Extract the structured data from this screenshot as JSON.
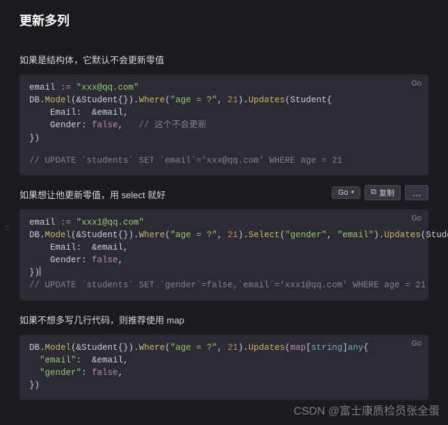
{
  "title": "更新多列",
  "para1": "如果是结构体，它默认不会更新零值",
  "para2": "如果想让他更新零值，用 select 就好",
  "para3": "如果不想多写几行代码，则推荐使用 map",
  "lang": "Go",
  "controls": {
    "go_label": "Go",
    "copy_label": "复制",
    "more": "…"
  },
  "gutter": "::",
  "watermark": "CSDN @富士康质检员张全蛋",
  "block1": {
    "l1a": "email ",
    "l1op": ":= ",
    "l1str": "\"xxx@qq.com\"",
    "l2a": "DB.",
    "l2fn1": "Model",
    "l2b": "(&Student{}).",
    "l2fn2": "Where",
    "l2c": "(",
    "l2str": "\"age = ?\"",
    "l2d": ", ",
    "l2num": "21",
    "l2e": ").",
    "l2fn3": "Updates",
    "l2f": "(Student{",
    "l3": "    Email:  &email,",
    "l4a": "    Gender: ",
    "l4b": "false",
    "l4c": ",   ",
    "l4cmt": "// 这个不会更新",
    "l5": "})",
    "cmt2": "// UPDATE `students` SET `email`='xxx@qq.com' WHERE age = 21"
  },
  "block2": {
    "l1a": "email ",
    "l1op": ":= ",
    "l1str": "\"xxx1@qq.com\"",
    "l2a": "DB.",
    "l2fn1": "Model",
    "l2b": "(&Student{}).",
    "l2fn2": "Where",
    "l2c": "(",
    "l2str": "\"age = ?\"",
    "l2d": ", ",
    "l2num": "21",
    "l2e": ").",
    "l2fn3": "Select",
    "l2f": "(",
    "l2sg": "\"gender\"",
    "l2g": ", ",
    "l2se": "\"email\"",
    "l2h": ").",
    "l2fn4": "Updates",
    "l2i": "(Student{",
    "l3": "    Email:  &email,",
    "l4a": "    Gender: ",
    "l4b": "false",
    "l4c": ",",
    "l5": "})",
    "cmt2": "// UPDATE `students` SET `gender`=false,`email`='xxx1@qq.com' WHERE age = 21"
  },
  "block3": {
    "l1a": "DB.",
    "l1fn1": "Model",
    "l1b": "(&Student{}).",
    "l1fn2": "Where",
    "l1c": "(",
    "l1str": "\"age = ?\"",
    "l1d": ", ",
    "l1num": "21",
    "l1e": ").",
    "l1fn3": "Updates",
    "l1f": "(",
    "l1kw": "map",
    "l1g": "[",
    "l1ty": "string",
    "l1h": "]",
    "l1any": "any",
    "l1i": "{",
    "l2a": "  ",
    "l2k": "\"email\"",
    "l2b": ":  &email,",
    "l3a": "  ",
    "l3k": "\"gender\"",
    "l3b": ": ",
    "l3v": "false",
    "l3c": ",",
    "l4": "})"
  }
}
